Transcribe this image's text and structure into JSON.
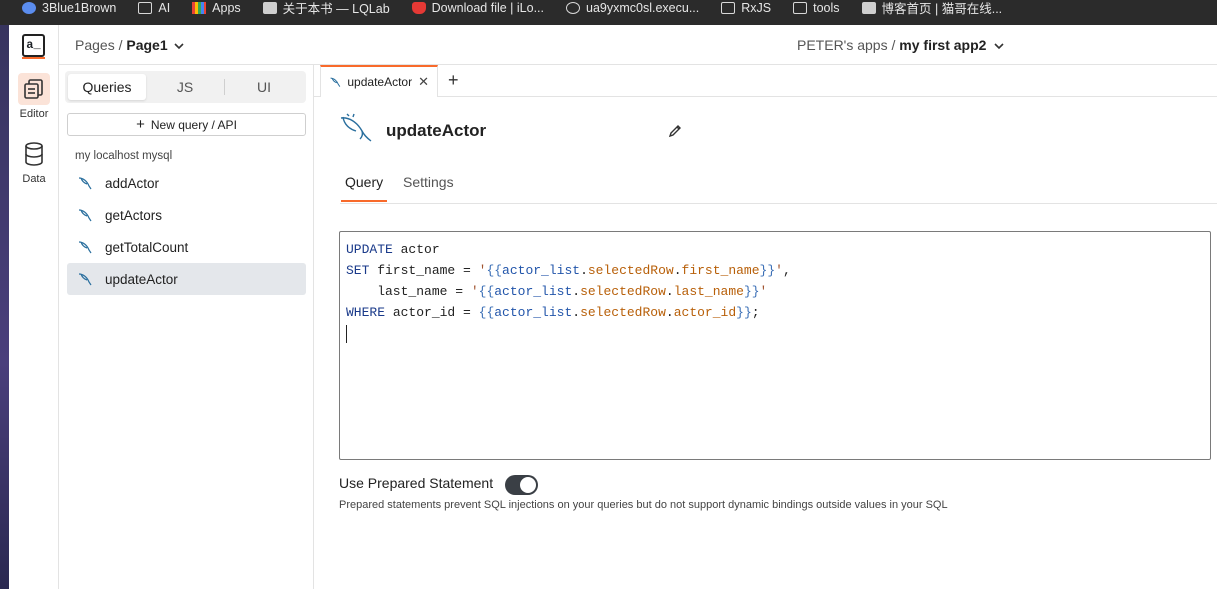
{
  "bookmarks": [
    {
      "label": "3Blue1Brown",
      "icon": "circle-icon"
    },
    {
      "label": "AI",
      "icon": "folder-icon"
    },
    {
      "label": "Apps",
      "icon": "grid-icon"
    },
    {
      "label": "关于本书 — LQLab",
      "icon": "image-icon"
    },
    {
      "label": "Download file | iLo...",
      "icon": "heart-icon"
    },
    {
      "label": "ua9yxmc0sl.execu...",
      "icon": "globe-icon"
    },
    {
      "label": "RxJS",
      "icon": "folder-icon"
    },
    {
      "label": "tools",
      "icon": "folder-icon"
    },
    {
      "label": "博客首页 | 猫哥在线...",
      "icon": "image-icon"
    }
  ],
  "rail": {
    "logo": "a_",
    "editor_label": "Editor",
    "data_label": "Data"
  },
  "header": {
    "pages_label": "Pages /",
    "page_name": "Page1",
    "workspace": "PETER's apps /",
    "app_name": "my first app2"
  },
  "explorer": {
    "tabs": [
      "Queries",
      "JS",
      "UI"
    ],
    "active_tab": "Queries",
    "new_query_label": "New query / API",
    "datasource": "my localhost mysql",
    "queries": [
      "addActor",
      "getActors",
      "getTotalCount",
      "updateActor"
    ],
    "selected_query": "updateActor"
  },
  "editor": {
    "open_tab": "updateActor",
    "query_name": "updateActor",
    "subtabs": [
      "Query",
      "Settings"
    ],
    "active_subtab": "Query"
  },
  "prepared": {
    "label": "Use Prepared Statement",
    "enabled": true,
    "description": "Prepared statements prevent SQL injections on your queries but do not support dynamic bindings outside values in your SQL"
  },
  "colors": {
    "accent": "#f86a2b",
    "toggle_on": "#3a3f45"
  }
}
